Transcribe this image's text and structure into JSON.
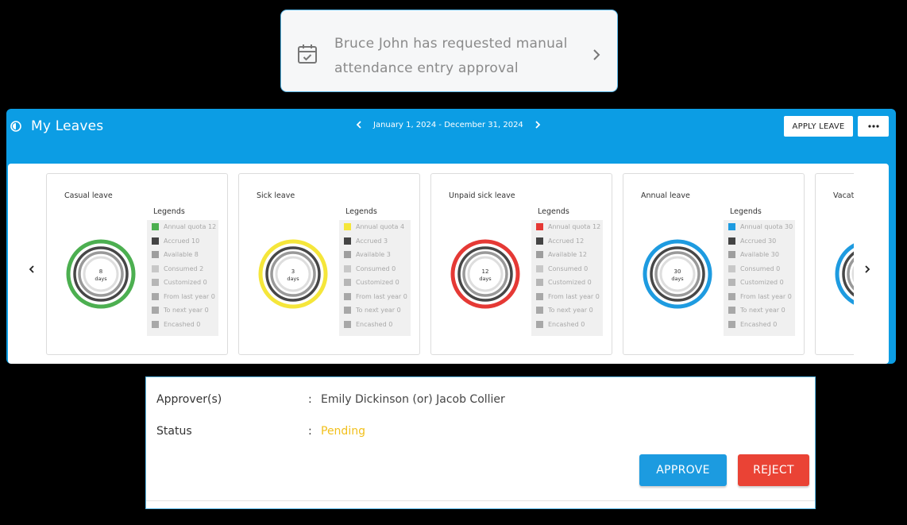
{
  "notification": {
    "message": "Bruce John has requested manual attendance entry approval",
    "icon": "calendar-check-icon"
  },
  "leaves": {
    "title": "My Leaves",
    "date_range": "January 1, 2024 - December 31, 2024",
    "apply_label": "APPLY LEAVE",
    "more_label": "•••",
    "legend_heading": "Legends",
    "cards": [
      {
        "title": "Casual leave",
        "color": "#4caf50",
        "days": "8",
        "unit": "days",
        "legend": [
          "Annual quota 12",
          "Accrued 10",
          "Available 8",
          "Consumed 2",
          "Customized 0",
          "From last year 0",
          "To next year 0",
          "Encashed 0"
        ]
      },
      {
        "title": "Sick leave",
        "color": "#f5e63a",
        "days": "3",
        "unit": "days",
        "legend": [
          "Annual quota 4",
          "Accrued 3",
          "Available 3",
          "Consumed 0",
          "Customized 0",
          "From last year 0",
          "To next year 0",
          "Encashed 0"
        ]
      },
      {
        "title": "Unpaid sick leave",
        "color": "#e53935",
        "days": "12",
        "unit": "days",
        "legend": [
          "Annual quota 12",
          "Accrued 12",
          "Available 12",
          "Consumed 0",
          "Customized 0",
          "From last year 0",
          "To next year 0",
          "Encashed 0"
        ]
      },
      {
        "title": "Annual leave",
        "color": "#1e9be0",
        "days": "30",
        "unit": "days",
        "legend": [
          "Annual quota 30",
          "Accrued 30",
          "Available 30",
          "Consumed 0",
          "Customized 0",
          "From last year 0",
          "To next year 0",
          "Encashed 0"
        ]
      },
      {
        "title": "Vacation",
        "color": "#1e9be0",
        "days": "",
        "unit": "",
        "legend": []
      }
    ]
  },
  "approval": {
    "approver_label": "Approver(s)",
    "approver_value": "Emily Dickinson (or) Jacob Collier",
    "status_label": "Status",
    "status_value": "Pending",
    "colon": ":",
    "approve_label": "APPROVE",
    "reject_label": "REJECT"
  },
  "colors": {
    "accent": "#0c9de4",
    "pending": "#f2c01c",
    "approve": "#1c9be0",
    "reject": "#ea4335"
  }
}
